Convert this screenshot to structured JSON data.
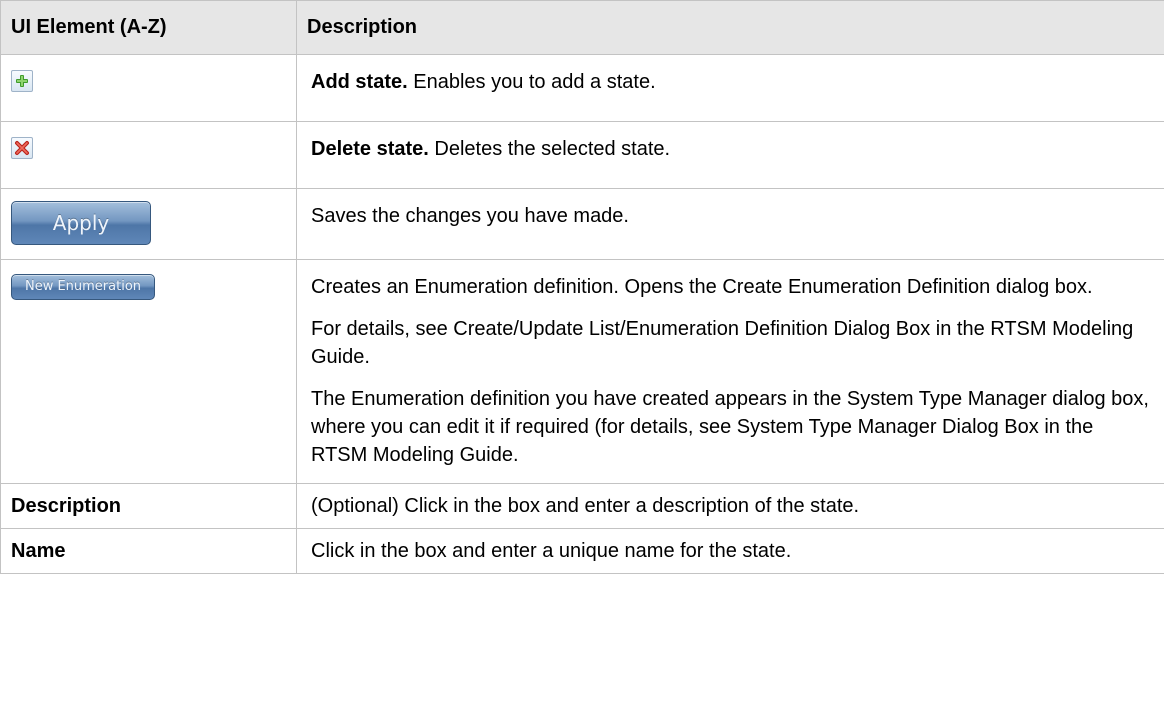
{
  "table": {
    "header": {
      "element": "UI Element (A-Z)",
      "description": "Description"
    },
    "rows": [
      {
        "element_icon": "add-icon",
        "label": "Add state.",
        "text": " Enables you to add a state."
      },
      {
        "element_icon": "delete-icon",
        "label": "Delete state.",
        "text": " Deletes the selected state."
      },
      {
        "element_button": "Apply",
        "text": "Saves the changes you have made."
      },
      {
        "element_button": "New Enumeration",
        "paragraphs": [
          "Creates an Enumeration definition. Opens the Create Enumeration Definition dialog box.",
          "For details, see Create/Update List/Enumeration Definition Dialog Box in the RTSM Modeling Guide.",
          "The Enumeration definition you have created appears in the System Type Manager dialog box, where you can edit it if required (for details, see System Type Manager Dialog Box in the RTSM Modeling Guide."
        ]
      },
      {
        "element": "Description",
        "text": "(Optional) Click in the box and enter a description of the state."
      },
      {
        "element": "Name",
        "text": "Click in the box and enter a unique name for the state."
      }
    ]
  }
}
